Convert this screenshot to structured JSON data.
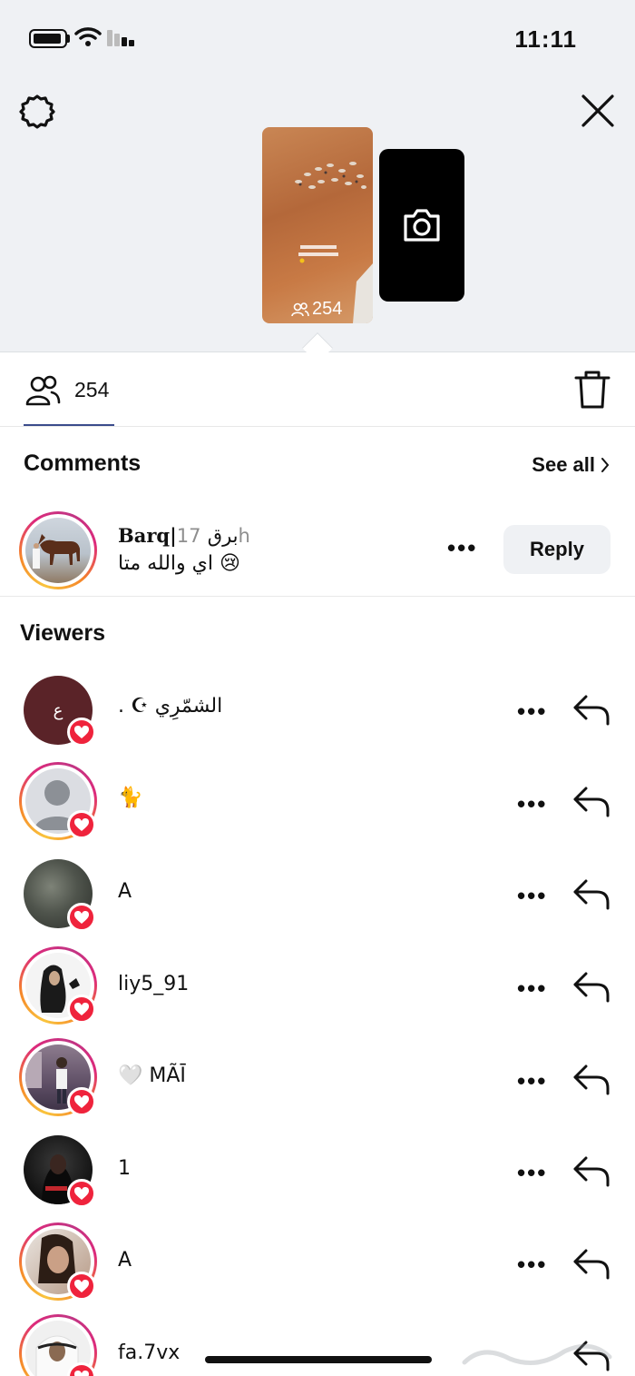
{
  "status_bar": {
    "time": "11:11"
  },
  "story": {
    "viewer_count": "254",
    "camera_icon": "camera-icon"
  },
  "viewers_tab": {
    "count": "254"
  },
  "comments": {
    "title": "Comments",
    "see_all": "See all",
    "items": [
      {
        "username": "Barq|",
        "username_arabic": "برق",
        "time": "17h",
        "text": "اي والله متا 😢",
        "reply_label": "Reply",
        "has_story_ring": true
      }
    ]
  },
  "viewers": {
    "title": "Viewers",
    "items": [
      {
        "name": ". ☪ الشمّرِي",
        "avatar_letter": "ع",
        "liked": true,
        "has_story_ring": false
      },
      {
        "name": "🐈",
        "liked": true,
        "has_story_ring": true
      },
      {
        "name": "A",
        "liked": true,
        "has_story_ring": false
      },
      {
        "name": "liy5_91",
        "liked": true,
        "has_story_ring": true
      },
      {
        "name": "🤍 MÃĪ",
        "liked": true,
        "has_story_ring": true
      },
      {
        "name": "1",
        "liked": true,
        "has_story_ring": false
      },
      {
        "name": "A",
        "liked": true,
        "has_story_ring": true
      },
      {
        "name": "fa.7vx",
        "liked": true,
        "has_story_ring": true
      }
    ]
  },
  "colors": {
    "heart": "#ef233c",
    "top_bg": "#eff1f4",
    "tab_underline": "#3b4c8c"
  }
}
